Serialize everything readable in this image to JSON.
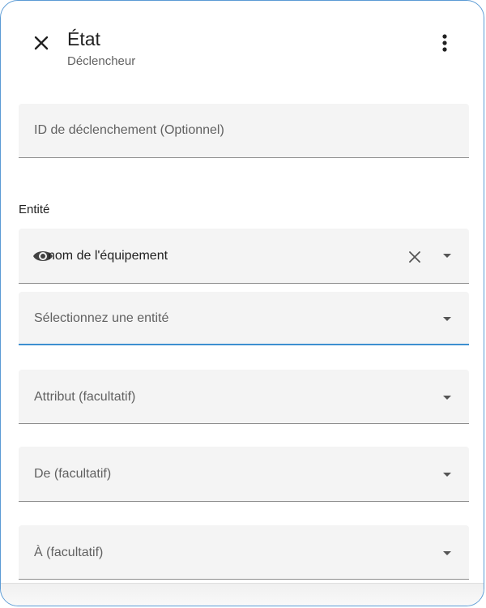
{
  "header": {
    "title": "État",
    "subtitle": "Déclencheur"
  },
  "fields": {
    "trigger_id_label": "ID de déclenchement (Optionnel)",
    "entity_section_label": "Entité",
    "entity_value": "nom de l'équipement",
    "select_entity_label": "Sélectionnez une entité",
    "attribute_label": "Attribut (facultatif)",
    "from_label": "De (facultatif)",
    "to_label": "À (facultatif)"
  },
  "colors": {
    "accent": "#3d8fd0",
    "border": "#5b9bd5",
    "field_bg": "#f4f4f4"
  },
  "icons": {
    "close": "close-icon",
    "more": "more-vertical-icon",
    "entity": "eye-icon",
    "clear": "clear-icon",
    "dropdown": "dropdown-arrow-icon"
  }
}
